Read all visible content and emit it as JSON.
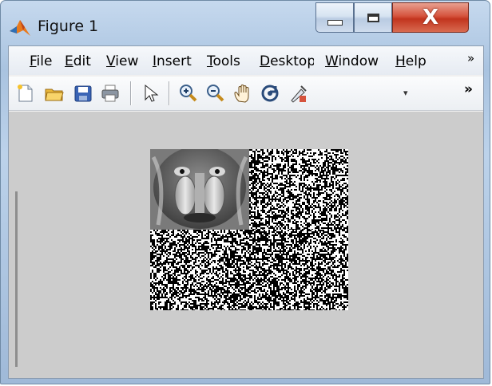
{
  "window": {
    "title": "Figure 1"
  },
  "caption_buttons": {
    "close_glyph": "X"
  },
  "menu": [
    {
      "name": "file",
      "label": "File"
    },
    {
      "name": "edit",
      "label": "Edit"
    },
    {
      "name": "view",
      "label": "View"
    },
    {
      "name": "insert",
      "label": "Insert"
    },
    {
      "name": "tools",
      "label": "Tools"
    },
    {
      "name": "desktop",
      "label": "Desktop"
    },
    {
      "name": "window",
      "label": "Window"
    },
    {
      "name": "help",
      "label": "Help"
    }
  ],
  "menu_overflow": "»",
  "toolbar": {
    "icons": [
      "new-figure-icon",
      "open-file-icon",
      "save-icon",
      "print-icon",
      "pointer-icon",
      "zoom-in-icon",
      "zoom-out-icon",
      "pan-hand-icon",
      "rotate-3d-icon",
      "data-cursor-icon"
    ],
    "dropdown_glyph": "▾",
    "overflow": "»"
  },
  "colors": {
    "canvas": "#cccccc",
    "accent_red": "#d5533d"
  },
  "figure": {
    "panels": [
      {
        "name": "baboon-original-image",
        "kind": "grayscale-photo"
      },
      {
        "name": "horizontal-detail-image",
        "kind": "binary-noise"
      },
      {
        "name": "vertical-detail-image",
        "kind": "binary-noise"
      },
      {
        "name": "diagonal-detail-image",
        "kind": "binary-noise"
      }
    ]
  }
}
